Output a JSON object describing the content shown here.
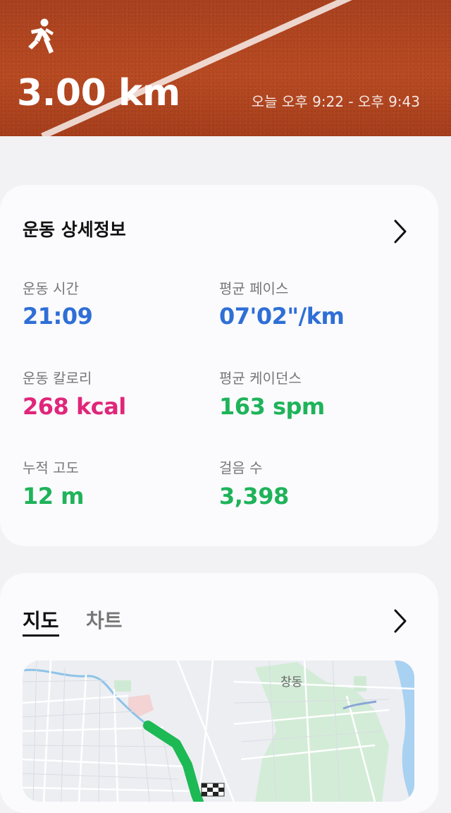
{
  "header": {
    "icon": "running-person-icon",
    "distance": "3.00 km",
    "time_range": "오늘 오후 9:22 - 오후 9:43"
  },
  "details": {
    "title": "운동 상세정보",
    "stats": [
      {
        "label": "운동 시간",
        "value": "21:09",
        "color": "#2f6fd6"
      },
      {
        "label": "평균 페이스",
        "value": "07'02\"/km",
        "color": "#2f6fd6"
      },
      {
        "label": "운동 칼로리",
        "value": "268 kcal",
        "color": "#e0267a"
      },
      {
        "label": "평균 케이던스",
        "value": "163 spm",
        "color": "#1fb35a"
      },
      {
        "label": "누적 고도",
        "value": "12 m",
        "color": "#1fb35a"
      },
      {
        "label": "걸음 수",
        "value": "3,398",
        "color": "#1fb35a"
      }
    ]
  },
  "map_card": {
    "tabs": [
      {
        "label": "지도",
        "active": true
      },
      {
        "label": "차트",
        "active": false
      }
    ],
    "place_label": "창동",
    "route_color": "#1db954"
  }
}
